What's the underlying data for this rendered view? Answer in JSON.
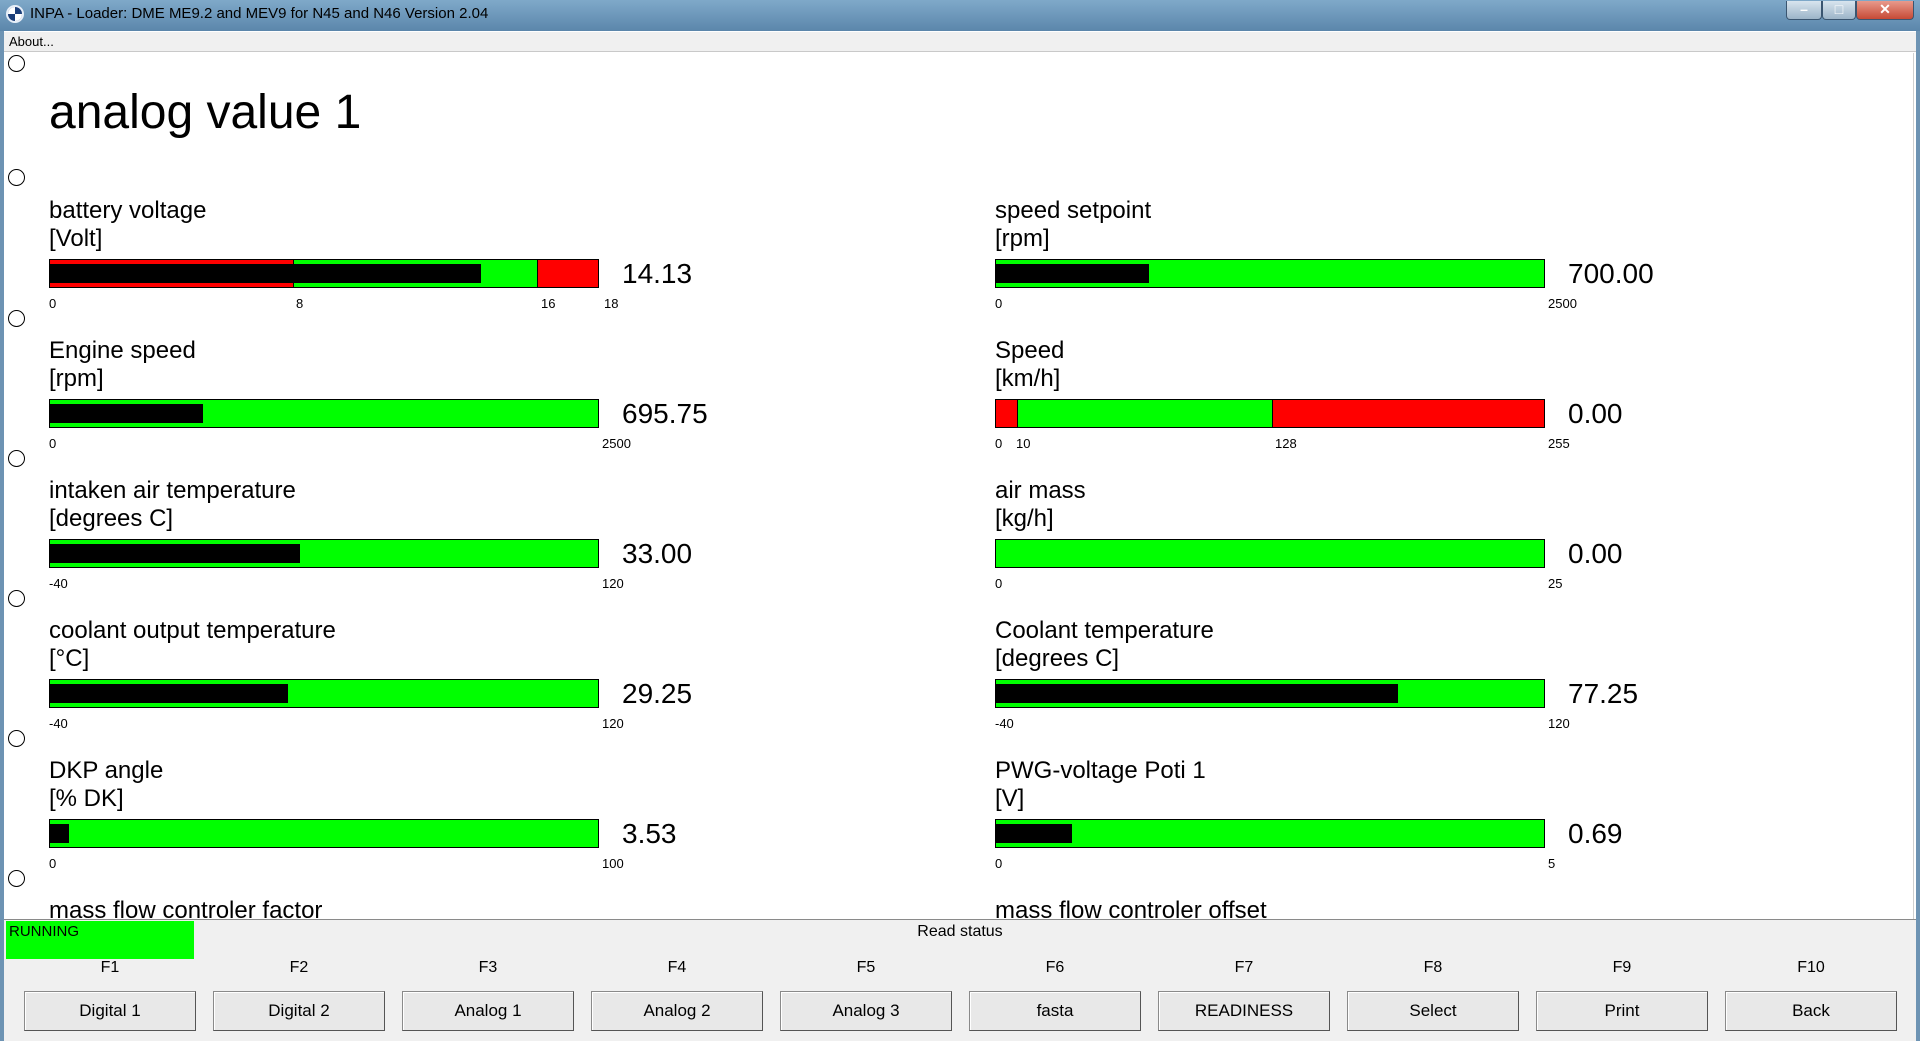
{
  "window": {
    "title": "INPA - Loader:  DME ME9.2 and MEV9 for N45 and N46 Version 2.04"
  },
  "menu": {
    "about": "About..."
  },
  "page": {
    "title": "analog value 1"
  },
  "gauges": [
    {
      "label": "battery voltage",
      "unit": "[Volt]",
      "value": "14.13",
      "ticks": [
        "0",
        "8",
        "16",
        "18"
      ]
    },
    {
      "label": "speed setpoint",
      "unit": "[rpm]",
      "value": "700.00",
      "ticks": [
        "0",
        "2500"
      ]
    },
    {
      "label": "Engine speed",
      "unit": "[rpm]",
      "value": "695.75",
      "ticks": [
        "0",
        "2500"
      ]
    },
    {
      "label": "Speed",
      "unit": "[km/h]",
      "value": "0.00",
      "ticks": [
        "0",
        "10",
        "128",
        "255"
      ]
    },
    {
      "label": "intaken air temperature",
      "unit": "[degrees C]",
      "value": "33.00",
      "ticks": [
        "-40",
        "120"
      ]
    },
    {
      "label": "air mass",
      "unit": "[kg/h]",
      "value": "0.00",
      "ticks": [
        "0",
        "25"
      ]
    },
    {
      "label": "coolant output temperature",
      "unit": "[°C]",
      "value": "29.25",
      "ticks": [
        "-40",
        "120"
      ]
    },
    {
      "label": "Coolant temperature",
      "unit": "[degrees C]",
      "value": "77.25",
      "ticks": [
        "-40",
        "120"
      ]
    },
    {
      "label": "DKP angle",
      "unit": "[% DK]",
      "value": "3.53",
      "ticks": [
        "0",
        "100"
      ]
    },
    {
      "label": "PWG-voltage Poti 1",
      "unit": "[V]",
      "value": "0.69",
      "ticks": [
        "0",
        "5"
      ]
    },
    {
      "label": "mass flow controler factor"
    },
    {
      "label": "mass flow controler offset"
    }
  ],
  "status": {
    "state": "RUNNING",
    "message": "Read status"
  },
  "fkeys": [
    {
      "key": "F1",
      "label": "Digital 1"
    },
    {
      "key": "F2",
      "label": "Digital 2"
    },
    {
      "key": "F3",
      "label": "Analog 1"
    },
    {
      "key": "F4",
      "label": "Analog 2"
    },
    {
      "key": "F5",
      "label": "Analog 3"
    },
    {
      "key": "F6",
      "label": "fasta"
    },
    {
      "key": "F7",
      "label": "READINESS"
    },
    {
      "key": "F8",
      "label": "Select"
    },
    {
      "key": "F9",
      "label": "Print"
    },
    {
      "key": "F10",
      "label": "Back"
    }
  ],
  "colors": {
    "in_range": "#00ff00",
    "out_of_range": "#ff0000",
    "level": "#000000",
    "status_running": "#00ff00"
  }
}
